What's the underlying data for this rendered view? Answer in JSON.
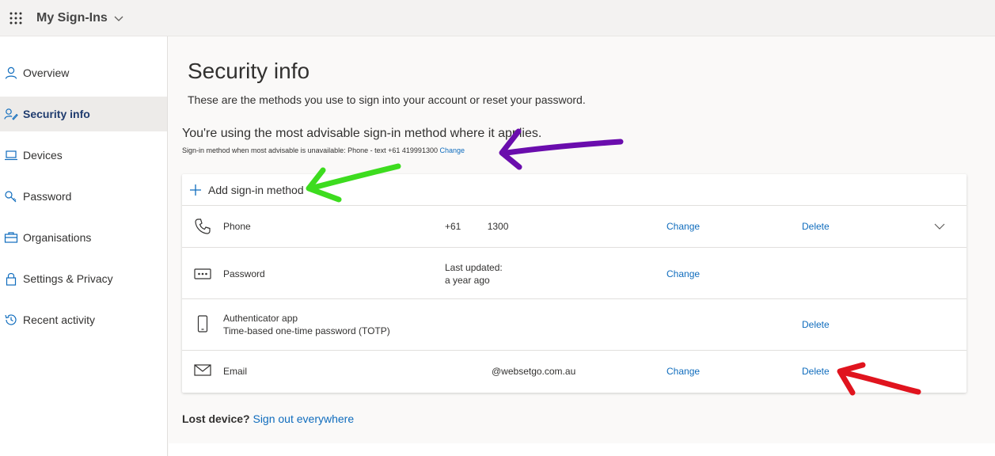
{
  "header": {
    "title": "My Sign-Ins"
  },
  "sidebar": {
    "items": [
      {
        "label": "Overview",
        "icon": "person-icon"
      },
      {
        "label": "Security info",
        "icon": "security-info-icon",
        "active": true
      },
      {
        "label": "Devices",
        "icon": "laptop-icon"
      },
      {
        "label": "Password",
        "icon": "key-icon"
      },
      {
        "label": "Organisations",
        "icon": "briefcase-icon"
      },
      {
        "label": "Settings & Privacy",
        "icon": "lock-icon"
      },
      {
        "label": "Recent activity",
        "icon": "history-icon"
      }
    ]
  },
  "main": {
    "title": "Security info",
    "description": "These are the methods you use to sign into your account or reset your password.",
    "advisable_text": "You're using the most advisable sign-in method where it applies.",
    "default_method_text": "Sign-in method when most advisable is unavailable: Phone - text +61 419991300",
    "default_method_change": "Change",
    "add_method_label": "Add sign-in method",
    "methods": [
      {
        "name": "Phone",
        "value": "+61          1300",
        "change": "Change",
        "delete": "Delete"
      },
      {
        "name": "Password",
        "value_line1": "Last updated:",
        "value_line2": "a year ago",
        "change": "Change"
      },
      {
        "name_line1": "Authenticator app",
        "name_line2": "Time-based one-time password (TOTP)",
        "delete": "Delete"
      },
      {
        "name": "Email",
        "value": "@websetgo.com.au",
        "change": "Change",
        "delete": "Delete"
      }
    ],
    "lost_device_label": "Lost device?",
    "sign_out_link": "Sign out everywhere"
  },
  "colors": {
    "accent": "#0f6cbd",
    "arrow_purple": "#6a0dad",
    "arrow_green": "#3ddc1f",
    "arrow_red": "#e0141e"
  }
}
